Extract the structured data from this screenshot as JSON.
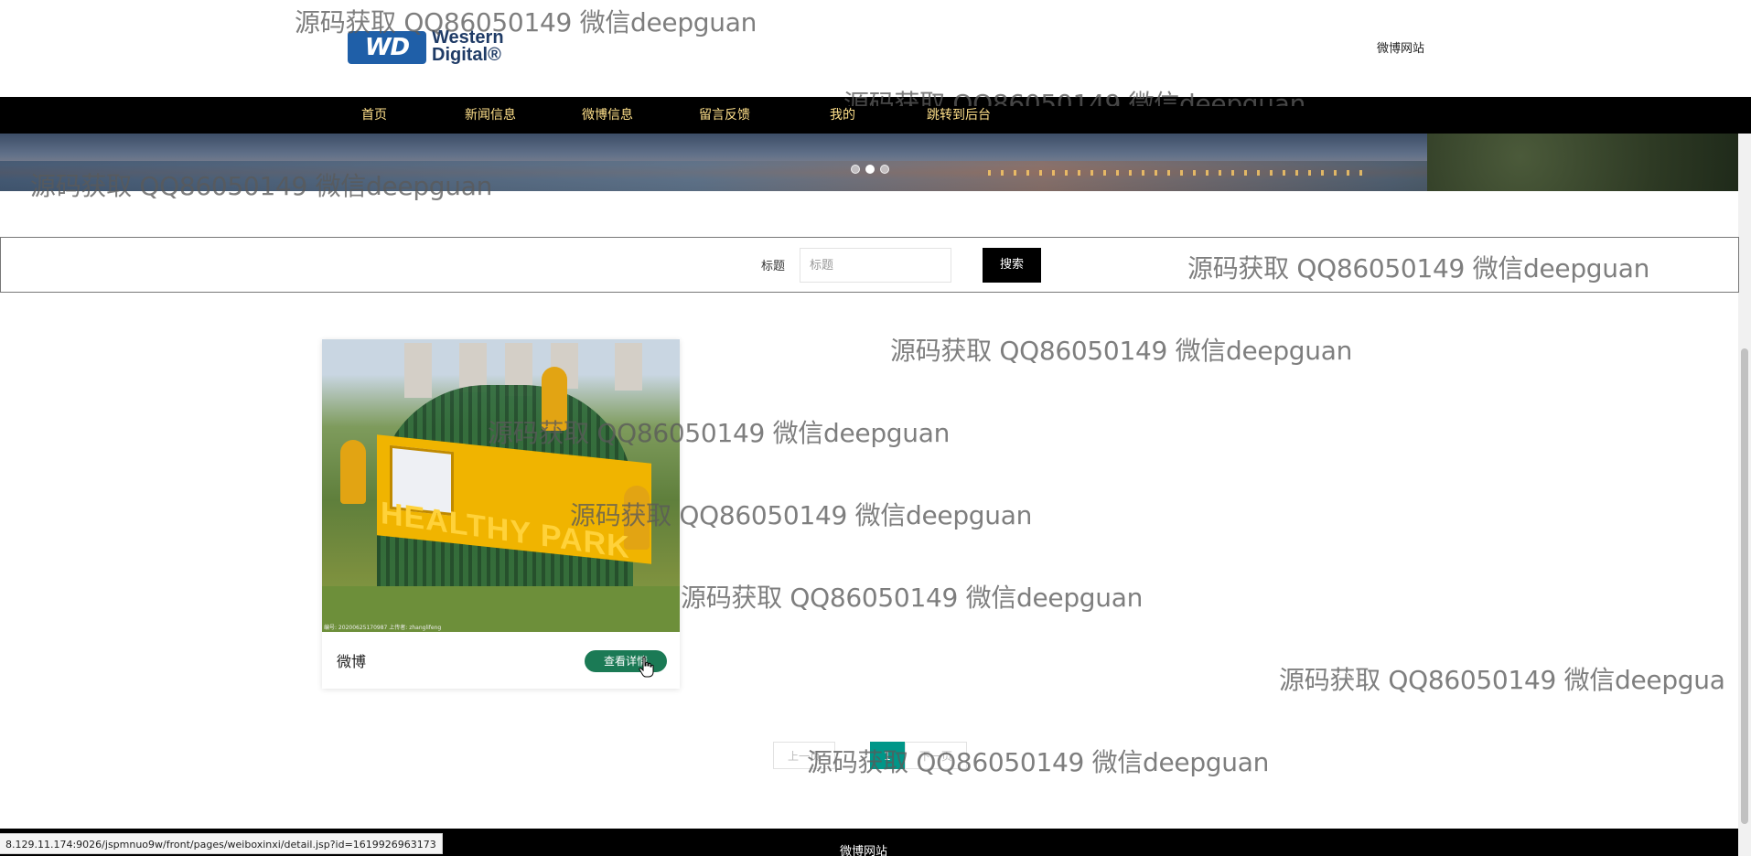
{
  "header": {
    "logo": {
      "mark": "WD",
      "name_line1": "Western",
      "name_line2": "Digital®"
    },
    "site_name": "微博网站"
  },
  "nav": {
    "items": [
      {
        "label": "首页"
      },
      {
        "label": "新闻信息"
      },
      {
        "label": "微博信息"
      },
      {
        "label": "留言反馈"
      },
      {
        "label": "我的"
      },
      {
        "label": "跳转到后台"
      }
    ],
    "text_color": "#ffe08a"
  },
  "banner": {
    "slides": 3,
    "active_slide": 2
  },
  "search": {
    "label": "标题",
    "placeholder": "标题",
    "value": "",
    "button_label": "搜索"
  },
  "card": {
    "title": "微博",
    "button_label": "查看详情",
    "image_text": "HEALTHY PARK",
    "image_caption": "编号: 20200625170987 上传者: zhanglifeng",
    "accent": "#1b7a55"
  },
  "pagination": {
    "prev_label": "上一页",
    "current_page": "1",
    "next_label": "下一页",
    "current_color": "#009688"
  },
  "footer": {
    "text": "微博网站"
  },
  "status_url": "8.129.11.174:9026/jspmnuo9w/front/pages/weiboxinxi/detail.jsp?id=1619926963173",
  "watermark": "源码获取 QQ86050149 微信deepguan",
  "watermark_cut": "源码获取 QQ86050149 微信deepgua"
}
